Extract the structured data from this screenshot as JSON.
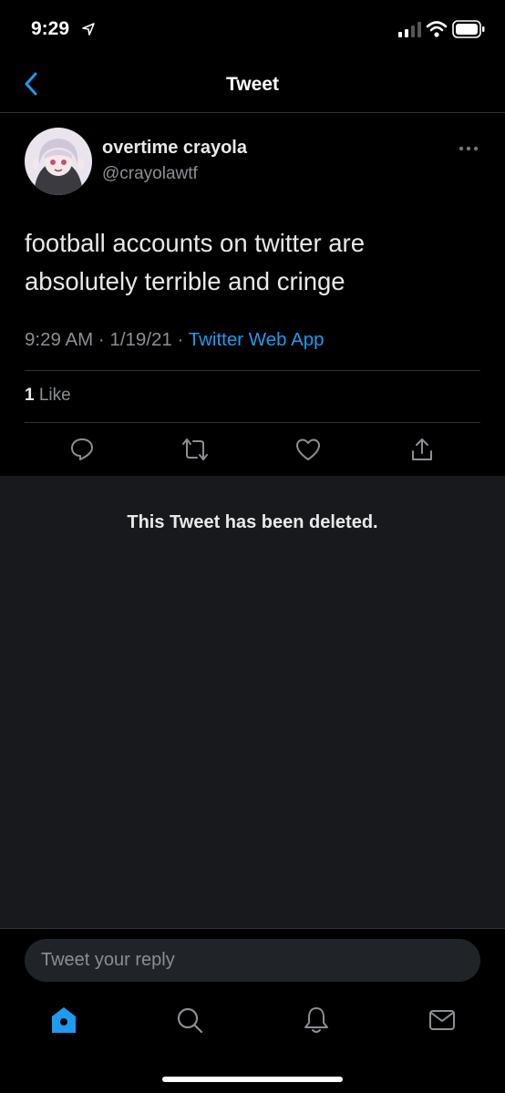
{
  "status_bar": {
    "time": "9:29"
  },
  "header": {
    "title": "Tweet"
  },
  "tweet": {
    "display_name": "overtime crayola",
    "handle": "@crayolawtf",
    "text": "football accounts on twitter are absolutely terrible and cringe",
    "time": "9:29 AM",
    "separator1": " · ",
    "date": "1/19/21",
    "separator2": " · ",
    "source": "Twitter Web App",
    "likes_count": "1",
    "likes_label": " Like"
  },
  "deleted": {
    "message": "This Tweet has been deleted."
  },
  "reply": {
    "placeholder": "Tweet your reply"
  },
  "colors": {
    "accent": "#1d9bf0",
    "background": "#000000",
    "panel": "#18191c"
  },
  "icons": {
    "back": "chevron-left-icon",
    "more": "more-horizontal-icon",
    "actions": [
      "reply-icon",
      "retweet-icon",
      "like-icon",
      "share-icon"
    ],
    "tabs": [
      "home-icon",
      "search-icon",
      "notifications-icon",
      "messages-icon"
    ]
  }
}
